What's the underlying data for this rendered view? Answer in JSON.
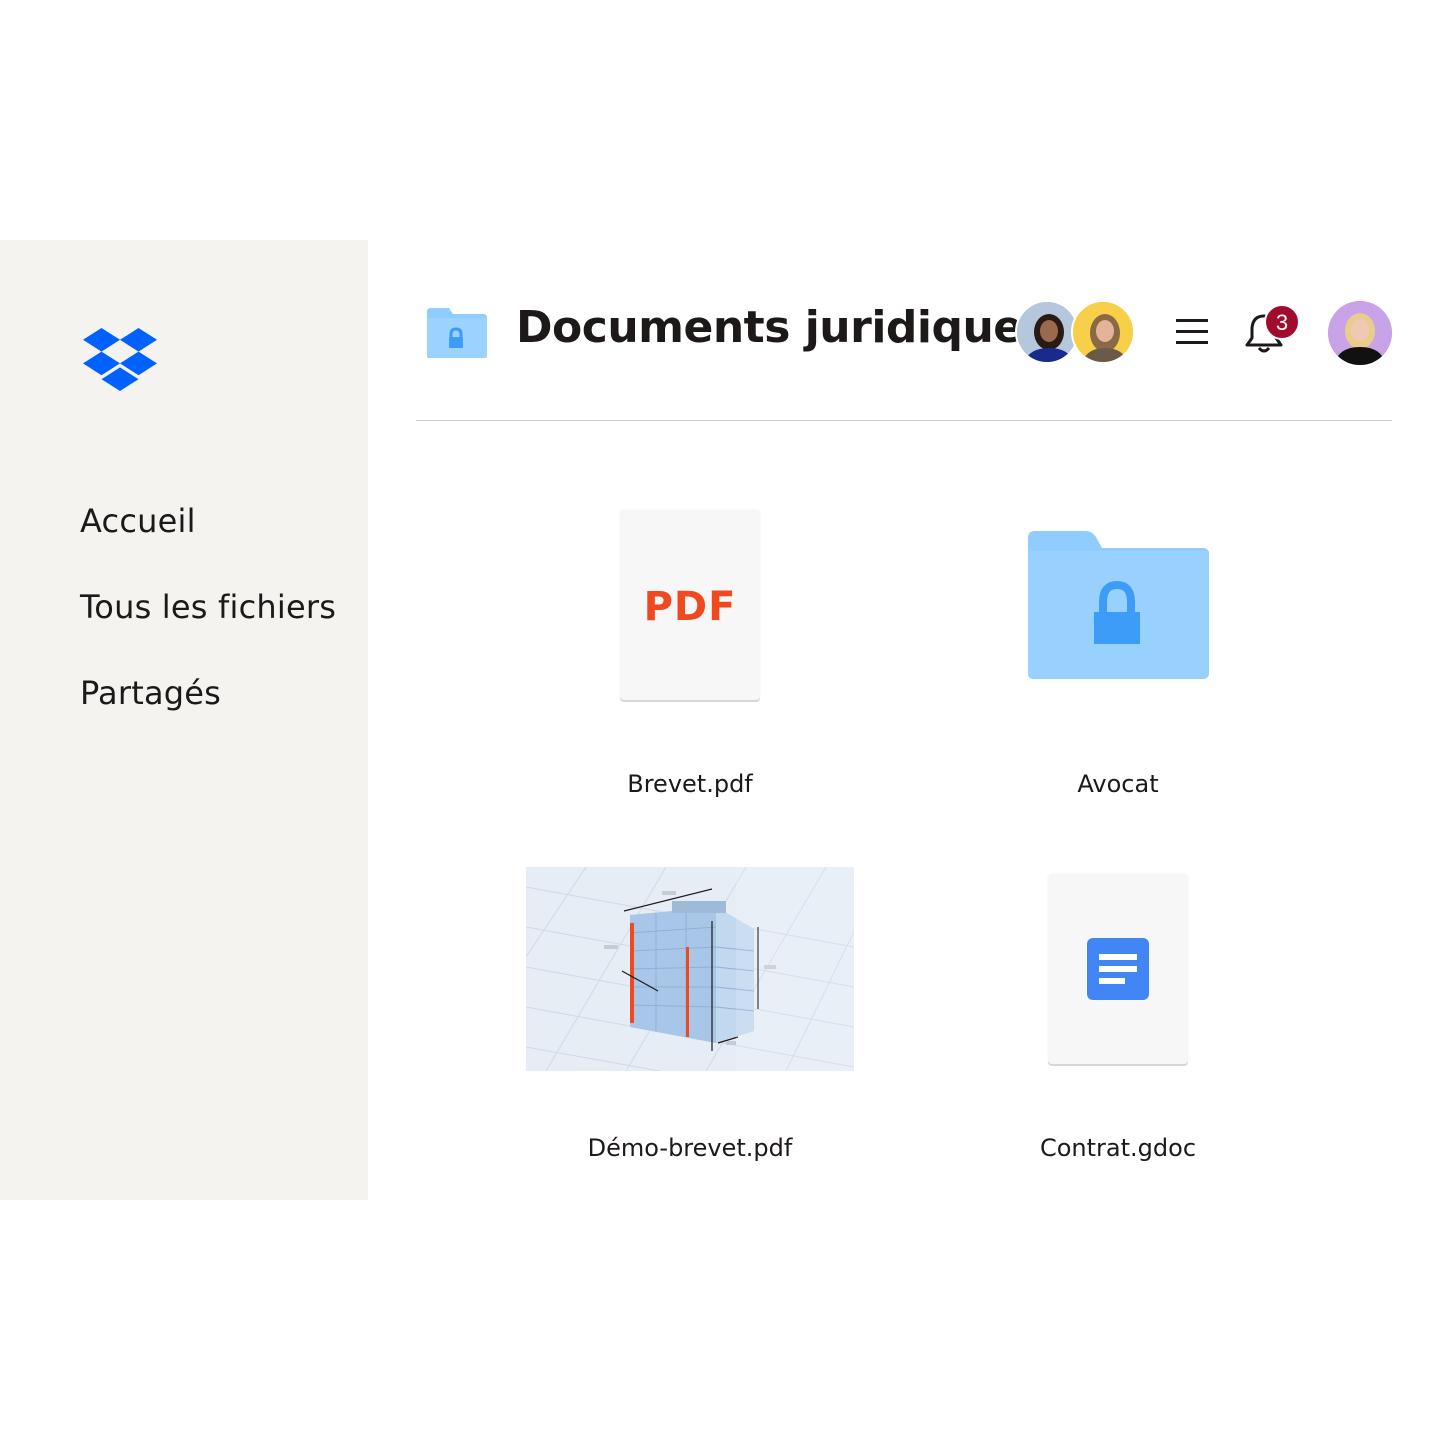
{
  "sidebar": {
    "logo_icon": "dropbox-logo-icon",
    "items": [
      {
        "label": "Accueil"
      },
      {
        "label": "Tous les fichiers"
      },
      {
        "label": "Partagés"
      }
    ]
  },
  "header": {
    "folder_icon": "locked-folder-icon",
    "title": "Documents juridiques",
    "menu_icon": "hamburger-menu-icon",
    "bell_icon": "bell-icon",
    "notification_count": "3"
  },
  "files": [
    {
      "name": "Brevet.pdf",
      "type": "pdf",
      "badge_text": "PDF"
    },
    {
      "name": "Avocat",
      "type": "locked-folder"
    },
    {
      "name": "Démo-brevet.pdf",
      "type": "image-preview"
    },
    {
      "name": "Contrat.gdoc",
      "type": "gdoc"
    }
  ],
  "colors": {
    "sidebar_bg": "#f5f3f0",
    "brand_blue": "#0061fe",
    "folder_blue": "#90ccfe",
    "folder_lock": "#3d9cf7",
    "pdf_orange": "#f0491f",
    "badge_red": "#a20c2c",
    "gdoc_blue": "#4285f4"
  }
}
